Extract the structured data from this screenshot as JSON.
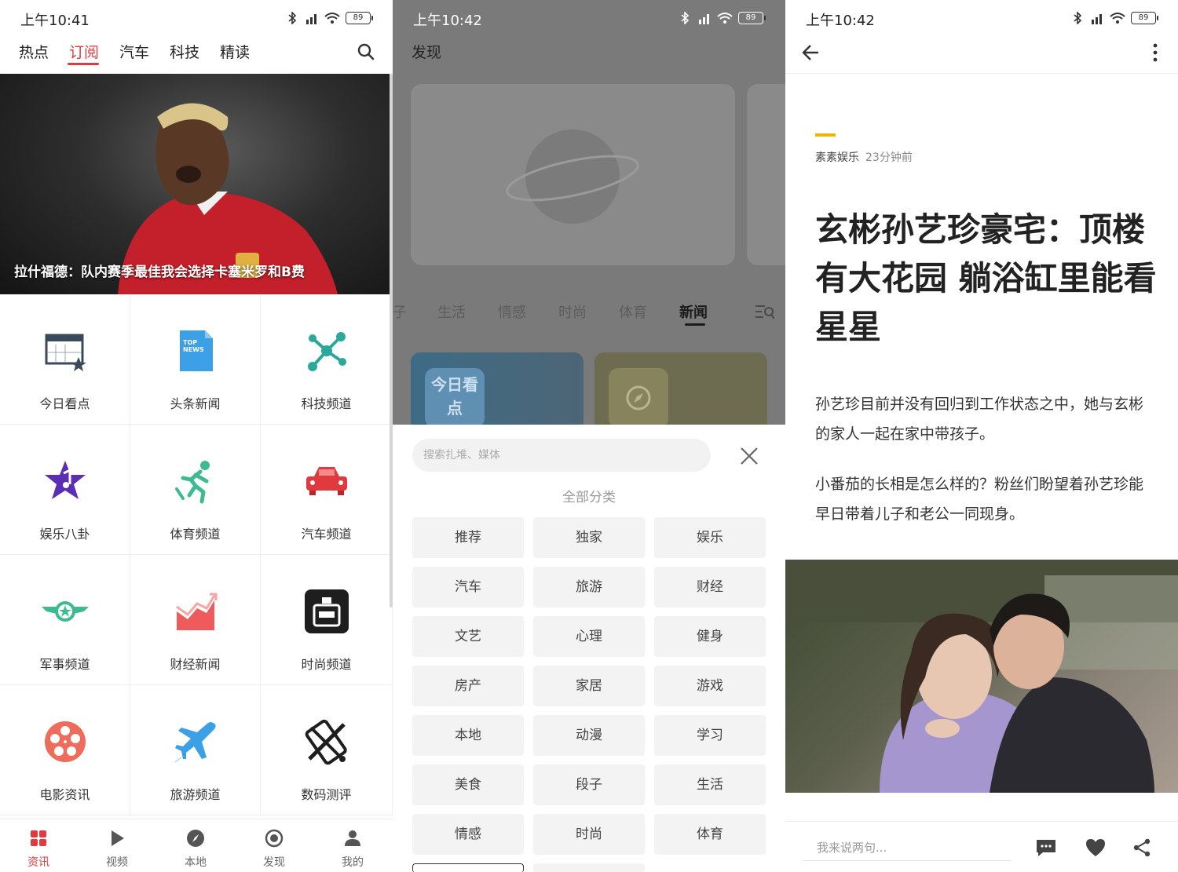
{
  "panel1": {
    "status": {
      "time": "上午10:41",
      "battery": "89"
    },
    "nav_tabs": [
      "热点",
      "订阅",
      "汽车",
      "科技",
      "精读"
    ],
    "active_tab": "订阅",
    "hero_caption": "拉什福德：队内赛季最佳我会选择卡塞米罗和B费",
    "channels": [
      {
        "label": "今日看点",
        "icon": "calendar-star-icon",
        "color": "#3b4a5a"
      },
      {
        "label": "头条新闻",
        "icon": "top-news-icon",
        "color": "#3ba0e6"
      },
      {
        "label": "科技频道",
        "icon": "molecule-icon",
        "color": "#2aa89a"
      },
      {
        "label": "娱乐八卦",
        "icon": "star-music-icon",
        "color": "#5b2fb5"
      },
      {
        "label": "体育频道",
        "icon": "runner-icon",
        "color": "#3dbb8e"
      },
      {
        "label": "汽车频道",
        "icon": "car-icon",
        "color": "#e0393e"
      },
      {
        "label": "军事频道",
        "icon": "winged-star-icon",
        "color": "#3dbb8e"
      },
      {
        "label": "财经新闻",
        "icon": "chart-up-icon",
        "color": "#ef5b5b"
      },
      {
        "label": "时尚频道",
        "icon": "perfume-icon",
        "color": "#1e1e1e"
      },
      {
        "label": "电影资讯",
        "icon": "film-reel-icon",
        "color": "#ef6b5b"
      },
      {
        "label": "旅游频道",
        "icon": "airplane-icon",
        "color": "#3ba0e6"
      },
      {
        "label": "数码测评",
        "icon": "tools-phone-icon",
        "color": "#1e1e1e"
      }
    ],
    "bottom_tabs": [
      {
        "label": "资讯",
        "icon": "grid-icon"
      },
      {
        "label": "视频",
        "icon": "play-icon"
      },
      {
        "label": "本地",
        "icon": "compass-icon"
      },
      {
        "label": "发现",
        "icon": "target-icon"
      },
      {
        "label": "我的",
        "icon": "user-icon"
      }
    ],
    "active_bottom_tab": "资讯",
    "accent": "#e0393e"
  },
  "panel2": {
    "status": {
      "time": "上午10:42",
      "battery": "89"
    },
    "title": "发现",
    "category_tabs": [
      "子",
      "生活",
      "情感",
      "时尚",
      "体育",
      "新闻"
    ],
    "active_category": "新闻",
    "card_logo_text": "今日看点",
    "sheet": {
      "search_placeholder": "搜索扎堆、媒体",
      "heading": "全部分类",
      "chips": [
        "推荐",
        "独家",
        "娱乐",
        "汽车",
        "旅游",
        "财经",
        "文艺",
        "心理",
        "健身",
        "房产",
        "家居",
        "游戏",
        "本地",
        "动漫",
        "学习",
        "美食",
        "段子",
        "生活",
        "情感",
        "时尚",
        "体育"
      ]
    }
  },
  "panel3": {
    "status": {
      "time": "上午10:42",
      "battery": "89"
    },
    "source": "素素娱乐",
    "time_ago": "23分钟前",
    "headline": "玄彬孙艺珍豪宅：顶楼有大花园 躺浴缸里能看星星",
    "paragraphs": [
      "孙艺珍目前并没有回归到工作状态之中，她与玄彬的家人一起在家中带孩子。",
      "小番茄的长相是怎么样的？粉丝们盼望着孙艺珍能早日带着儿子和老公一同现身。"
    ],
    "comment_placeholder": "我来说两句...",
    "accent": "#f0b400"
  }
}
